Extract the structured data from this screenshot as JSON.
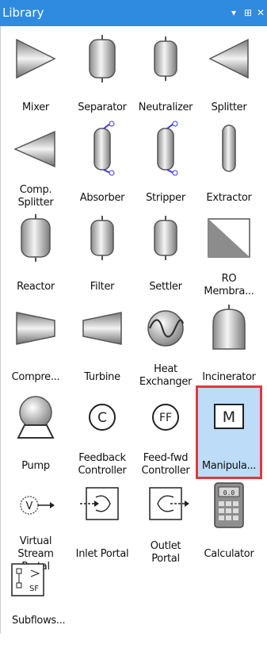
{
  "panel_title": "Library",
  "controls": {
    "dropdown": "▾",
    "pin": "⊞",
    "close": "✕"
  },
  "colors": {
    "titlebar": "#2e8bdf",
    "selection": "#bcdcf7",
    "highlight": "#e0393b"
  },
  "items": [
    {
      "label": "Mixer",
      "icon": "mixer-icon"
    },
    {
      "label": "Separator",
      "icon": "separator-icon"
    },
    {
      "label": "Neutralizer",
      "icon": "neutralizer-icon"
    },
    {
      "label": "Splitter",
      "icon": "splitter-icon"
    },
    {
      "label": "Comp.\nSplitter",
      "icon": "comp-splitter-icon"
    },
    {
      "label": "Absorber",
      "icon": "absorber-icon"
    },
    {
      "label": "Stripper",
      "icon": "stripper-icon"
    },
    {
      "label": "Extractor",
      "icon": "extractor-icon"
    },
    {
      "label": "Reactor",
      "icon": "reactor-icon"
    },
    {
      "label": "Filter",
      "icon": "filter-icon"
    },
    {
      "label": "Settler",
      "icon": "settler-icon"
    },
    {
      "label": "RO\nMembra...",
      "icon": "ro-membrane-icon"
    },
    {
      "label": "Compre...",
      "icon": "compressor-icon"
    },
    {
      "label": "Turbine",
      "icon": "turbine-icon"
    },
    {
      "label": "Heat\nExchanger",
      "icon": "heat-exchanger-icon"
    },
    {
      "label": "Incinerator",
      "icon": "incinerator-icon"
    },
    {
      "label": "Pump",
      "icon": "pump-icon"
    },
    {
      "label": "Feedback\nController",
      "icon": "feedback-controller-icon",
      "glyph": "C"
    },
    {
      "label": "Feed-fwd\nController",
      "icon": "feedforward-controller-icon",
      "glyph": "FF"
    },
    {
      "label": "Manipula...",
      "icon": "manipulator-icon",
      "glyph": "M",
      "selected": true
    },
    {
      "label": "Virtual\nStream\nPortal",
      "icon": "virtual-stream-portal-icon",
      "glyph": "V"
    },
    {
      "label": "Inlet Portal",
      "icon": "inlet-portal-icon"
    },
    {
      "label": "Outlet\nPortal",
      "icon": "outlet-portal-icon"
    },
    {
      "label": "Calculator",
      "icon": "calculator-icon",
      "glyph": "0.0"
    },
    {
      "label": "Subflows...",
      "icon": "subflows-icon",
      "glyph": "SF"
    }
  ]
}
